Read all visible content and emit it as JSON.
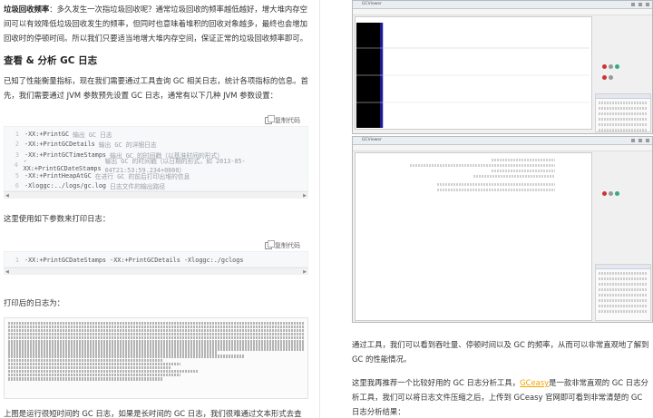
{
  "left": {
    "intro_bold": "垃圾回收频率",
    "intro_text": "：多久发生一次指垃圾回收呢？通常垃圾回收的频率越低越好，增大堆内存空间可以有效降低垃圾回收发生的频率，但同时也意味着堆积的回收对象越多，最终也会增加回收时的停顿时间。所以我们只要适当地增大堆内存空间，保证正常的垃圾回收频率即可。",
    "heading": "查看 & 分析 GC 日志",
    "para1": "已知了性能衡量指标，现在我们需要通过工具查询 GC 相关日志，统计各项指标的信息。首先，我们需要通过 JVM 参数预先设置 GC 日志，通常有以下几种 JVM 参数设置：",
    "copy_label": "复制代码",
    "code1": [
      {
        "n": "1",
        "code": "-XX:+PrintGC",
        "comment": "输出 GC 日志"
      },
      {
        "n": "2",
        "code": "-XX:+PrintGCDetails",
        "comment": "输出 GC 的详细日志"
      },
      {
        "n": "3",
        "code": "-XX:+PrintGCTimeStamps",
        "comment": "输出 GC 的时间戳（以基准时间的形式）"
      },
      {
        "n": "4",
        "code": "-XX:+PrintGCDateStamps",
        "comment": "输出 GC 的时间戳（以日期的形式，如 2013-05-04T21:53:59.234+0800）"
      },
      {
        "n": "5",
        "code": "-XX:+PrintHeapAtGC",
        "comment": "在进行 GC 的前后打印出堆的信息"
      },
      {
        "n": "6",
        "code": "-Xloggc:../logs/gc.log",
        "comment": "日志文件的输出路径"
      }
    ],
    "para2": "这里使用如下参数来打印日志：",
    "code2": [
      {
        "n": "1",
        "code": "-XX:+PrintGCDateStamps -XX:+PrintGCDetails -Xloggc:./gclogs",
        "comment": ""
      }
    ],
    "para3": "打印后的日志为：",
    "para4": "上图是运行很短时间的 GC 日志，如果是长时间的 GC 日志，我们很难通过文本形式去查"
  },
  "right": {
    "win1_title": "GCViewer",
    "win2_title": "GCViewer",
    "caption1": "通过工具，我们可以看到吞吐量、停顿时间以及 GC 的频率，从而可以非常直观地了解到 GC 的性能情况。",
    "caption2_pre": "这里我再推荐一个比较好用的 GC 日志分析工具，",
    "caption2_link": "GCeasy",
    "caption2_post": "是一款非常直观的 GC 日志分析工具，我们可以将日志文件压缩之后，上传到 GCeasy 官网即可看到非常清楚的 GC 日志分析结果："
  }
}
